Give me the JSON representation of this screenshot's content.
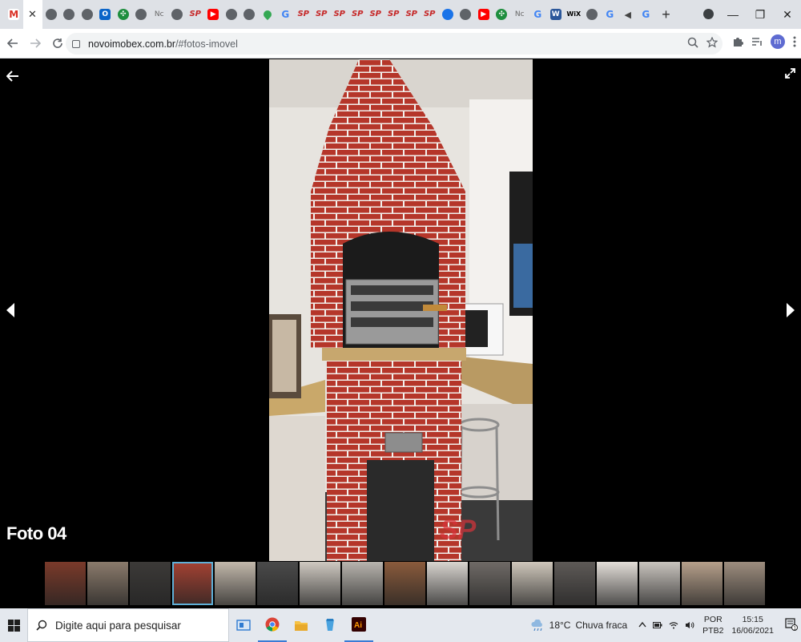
{
  "browser": {
    "tabs": [
      {
        "icon": "gmail-icon",
        "glyph": "M",
        "style": "fav-gmail"
      },
      {
        "icon": "close-tab-icon",
        "glyph": "✕",
        "style": "fav-x",
        "active": true
      },
      {
        "icon": "globe-icon",
        "glyph": "",
        "style": "fav-globe"
      },
      {
        "icon": "globe-icon",
        "glyph": "",
        "style": "fav-globe"
      },
      {
        "icon": "globe-icon",
        "glyph": "",
        "style": "fav-globe"
      },
      {
        "icon": "outlook-icon",
        "glyph": "O",
        "style": "fav-outlook"
      },
      {
        "icon": "clover-icon",
        "glyph": "✣",
        "style": "fav-clover"
      },
      {
        "icon": "globe-icon",
        "glyph": "",
        "style": "fav-globe"
      },
      {
        "icon": "nc-icon",
        "glyph": "Nc",
        "style": "fav-nc"
      },
      {
        "icon": "globe-icon",
        "glyph": "",
        "style": "fav-globe"
      },
      {
        "icon": "sp-icon",
        "glyph": "SP",
        "style": "fav-sp"
      },
      {
        "icon": "youtube-icon",
        "glyph": "▶",
        "style": "fav-yt"
      },
      {
        "icon": "globe-icon",
        "glyph": "",
        "style": "fav-globe"
      },
      {
        "icon": "globe-icon",
        "glyph": "",
        "style": "fav-globe"
      },
      {
        "icon": "maps-icon",
        "glyph": "",
        "style": "fav-maps"
      },
      {
        "icon": "google-icon",
        "glyph": "G",
        "style": "fav-g"
      },
      {
        "icon": "sp-icon",
        "glyph": "SP",
        "style": "fav-sp"
      },
      {
        "icon": "sp-icon",
        "glyph": "SP",
        "style": "fav-sp"
      },
      {
        "icon": "sp-icon",
        "glyph": "SP",
        "style": "fav-sp"
      },
      {
        "icon": "sp-icon",
        "glyph": "SP",
        "style": "fav-sp"
      },
      {
        "icon": "sp-icon",
        "glyph": "SP",
        "style": "fav-sp"
      },
      {
        "icon": "sp-icon",
        "glyph": "SP",
        "style": "fav-sp"
      },
      {
        "icon": "sp-icon",
        "glyph": "SP",
        "style": "fav-sp"
      },
      {
        "icon": "sp-icon",
        "glyph": "SP",
        "style": "fav-sp"
      },
      {
        "icon": "blue-circle-icon",
        "glyph": "",
        "style": "fav-blue"
      },
      {
        "icon": "globe-icon",
        "glyph": "",
        "style": "fav-globe"
      },
      {
        "icon": "youtube-icon",
        "glyph": "▶",
        "style": "fav-yt"
      },
      {
        "icon": "clover-icon",
        "glyph": "✣",
        "style": "fav-clover"
      },
      {
        "icon": "nc-icon",
        "glyph": "Nc",
        "style": "fav-nc"
      },
      {
        "icon": "google-icon",
        "glyph": "G",
        "style": "fav-g"
      },
      {
        "icon": "word-icon",
        "glyph": "W",
        "style": "fav-word"
      },
      {
        "icon": "wix-icon",
        "glyph": "WiX",
        "style": "fav-wix"
      },
      {
        "icon": "globe-icon",
        "glyph": "",
        "style": "fav-globe"
      },
      {
        "icon": "google-icon",
        "glyph": "G",
        "style": "fav-g"
      },
      {
        "icon": "speaker-icon",
        "glyph": "◀",
        "style": "fav-sound"
      },
      {
        "icon": "google-icon",
        "glyph": "G",
        "style": "fav-g"
      }
    ],
    "new_tab": "+",
    "window_controls": {
      "minimize": "—",
      "restore": "❐",
      "close": "✕"
    },
    "url_host": "novoimobex.com.br",
    "url_path": "/#fotos-imovel",
    "profile_initial": "m"
  },
  "viewer": {
    "caption": "Foto 04",
    "watermark": "SP",
    "prev_arrow": "◀",
    "next_arrow": "▶",
    "back_arrow": "←",
    "expand_glyph": "⤢",
    "selected_index": 3,
    "thumbnails": [
      {
        "label": "thumb-1",
        "bg": "#7a3a2a"
      },
      {
        "label": "thumb-2",
        "bg": "#8b7b6c"
      },
      {
        "label": "thumb-3",
        "bg": "#3c3a38"
      },
      {
        "label": "thumb-4",
        "bg": "#a44233"
      },
      {
        "label": "thumb-5",
        "bg": "#c2b8ab"
      },
      {
        "label": "thumb-6",
        "bg": "#4a4a4a"
      },
      {
        "label": "thumb-7",
        "bg": "#cfc9c1"
      },
      {
        "label": "thumb-8",
        "bg": "#b8b4ae"
      },
      {
        "label": "thumb-9",
        "bg": "#8a5b3c"
      },
      {
        "label": "thumb-10",
        "bg": "#d8d4cf"
      },
      {
        "label": "thumb-11",
        "bg": "#6f6a66"
      },
      {
        "label": "thumb-12",
        "bg": "#cfc7bb"
      },
      {
        "label": "thumb-13",
        "bg": "#5e5a57"
      },
      {
        "label": "thumb-14",
        "bg": "#e3ded8"
      },
      {
        "label": "thumb-15",
        "bg": "#c9c4be"
      },
      {
        "label": "thumb-16",
        "bg": "#b6a08b"
      },
      {
        "label": "thumb-17",
        "bg": "#9d8d7e"
      }
    ]
  },
  "taskbar": {
    "search_placeholder": "Digite aqui para pesquisar",
    "weather_temp": "18°C",
    "weather_desc": "Chuva fraca",
    "lang_top": "POR",
    "lang_bottom": "PTB2",
    "time": "15:15",
    "date": "16/06/2021",
    "notifications": "1"
  },
  "colors": {
    "thumb_selected_border": "#5fb0d8",
    "brick_red": "#b5362a",
    "taskbar_bg": "#e4e8ee"
  }
}
